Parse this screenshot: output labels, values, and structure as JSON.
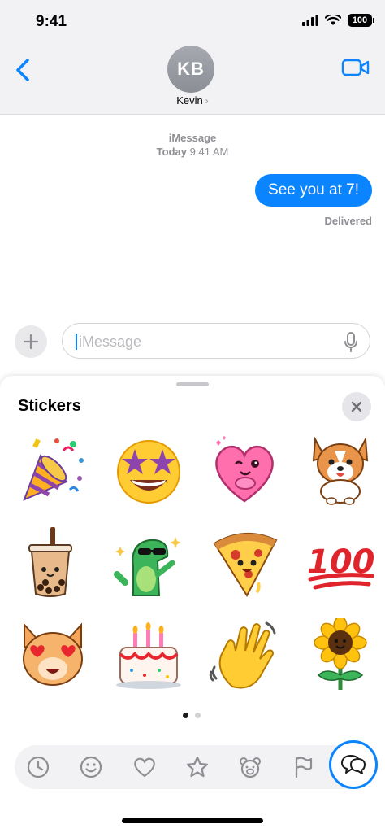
{
  "status": {
    "time": "9:41",
    "battery": "100"
  },
  "contact": {
    "initials": "KB",
    "name": "Kevin"
  },
  "thread": {
    "service": "iMessage",
    "date_day": "Today",
    "date_time": "9:41 AM",
    "message": "See you at 7!",
    "receipt": "Delivered"
  },
  "composer": {
    "placeholder": "iMessage"
  },
  "sheet": {
    "title": "Stickers",
    "stickers": [
      "party-popper",
      "star-struck",
      "hugging-heart",
      "corgi",
      "boba-tea",
      "cool-dinosaur",
      "pizza-slice",
      "hundred-points",
      "heart-eyes-cat",
      "birthday-cake",
      "waving-hand",
      "sunflower"
    ],
    "page_count": 2,
    "current_page": 1
  },
  "toolbar": {
    "items": [
      "recents-clock-icon",
      "emoji-smiley-icon",
      "heart-icon",
      "star-icon",
      "bear-icon",
      "flag-icon",
      "speech-bubbles-icon"
    ],
    "selected": "speech-bubbles-icon"
  },
  "colors": {
    "accent": "#0a84ff",
    "bubble": "#0a84ff"
  }
}
